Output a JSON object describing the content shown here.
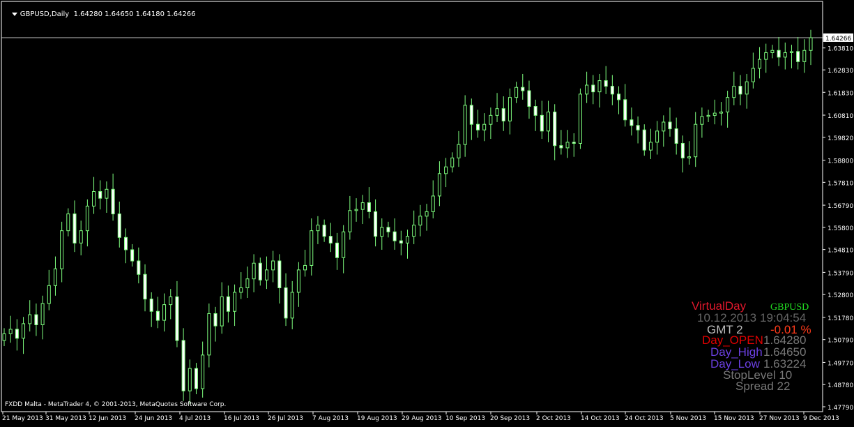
{
  "header": {
    "symbol": "GBPUSD,Daily",
    "ohlc": "1.64280 1.64650 1.64180 1.64266"
  },
  "footer": {
    "copyright": "FXDD Malta - MetaTrader 4, © 2001-2013, MetaQuotes Software Corp."
  },
  "price_tag": "1.64266",
  "colors": {
    "background": "#000000",
    "grid": "#ffffff",
    "candle": "#7fff7f",
    "price_line": "#c0c0c0"
  },
  "info_panel": {
    "title": "VirtualDay",
    "symbol": "GBPUSD",
    "date": "10.12.2013",
    "time": "19:04:54",
    "gmt": "GMT 2",
    "change": "-0.01 %",
    "open_label": "Day_OPEN",
    "open_value": "1.64280",
    "high_label": "Day_High",
    "high_value": "1.64650",
    "low_label": "Day_Low",
    "low_value": "1.63224",
    "stoplevel": "StopLevel 10",
    "spread": "Spread  22"
  },
  "chart_data": {
    "type": "candlestick",
    "title": "GBPUSD,Daily",
    "ylim": [
      1.4779,
      1.6458
    ],
    "y_ticks": [
      "1.64266",
      "1.63810",
      "1.62830",
      "1.61830",
      "1.60810",
      "1.59820",
      "1.58800",
      "1.57810",
      "1.56790",
      "1.55800",
      "1.54810",
      "1.53790",
      "1.52800",
      "1.51780",
      "1.50790",
      "1.49770",
      "1.48780",
      "1.47790"
    ],
    "x_ticks": [
      "21 May 2013",
      "31 May 2013",
      "12 Jun 2013",
      "24 Jun 2013",
      "4 Jul 2013",
      "16 Jul 2013",
      "26 Jul 2013",
      "7 Aug 2013",
      "19 Aug 2013",
      "29 Aug 2013",
      "10 Sep 2013",
      "20 Sep 2013",
      "2 Oct 2013",
      "14 Oct 2013",
      "24 Oct 2013",
      "5 Nov 2013",
      "15 Nov 2013",
      "27 Nov 2013",
      "9 Dec 2013"
    ],
    "closes": [
      1.5105,
      1.5125,
      1.5085,
      1.515,
      1.519,
      1.5145,
      1.524,
      1.532,
      1.5395,
      1.5565,
      1.564,
      1.551,
      1.5565,
      1.5675,
      1.574,
      1.571,
      1.575,
      1.564,
      1.5535,
      1.548,
      1.543,
      1.537,
      1.526,
      1.5205,
      1.5165,
      1.5235,
      1.527,
      1.5075,
      1.485,
      1.495,
      1.486,
      1.501,
      1.5195,
      1.514,
      1.527,
      1.5205,
      1.529,
      1.531,
      1.535,
      1.542,
      1.5345,
      1.539,
      1.543,
      1.531,
      1.5175,
      1.529,
      1.539,
      1.541,
      1.5565,
      1.559,
      1.554,
      1.551,
      1.5445,
      1.556,
      1.5655,
      1.566,
      1.569,
      1.565,
      1.554,
      1.558,
      1.556,
      1.552,
      1.551,
      1.554,
      1.559,
      1.563,
      1.565,
      1.572,
      1.582,
      1.585,
      1.589,
      1.595,
      1.6125,
      1.604,
      1.6015,
      1.604,
      1.608,
      1.611,
      1.6055,
      1.616,
      1.6205,
      1.619,
      1.612,
      1.608,
      1.601,
      1.6095,
      1.5945,
      1.5935,
      1.596,
      1.5955,
      1.6175,
      1.6215,
      1.6185,
      1.6235,
      1.621,
      1.6175,
      1.615,
      1.606,
      1.6035,
      1.6015,
      1.5925,
      1.596,
      1.601,
      1.605,
      1.602,
      1.5955,
      1.589,
      1.5895,
      1.604,
      1.6075,
      1.608,
      1.609,
      1.6095,
      1.616,
      1.621,
      1.6175,
      1.623,
      1.629,
      1.633,
      1.636,
      1.637,
      1.634,
      1.636,
      1.6365,
      1.632,
      1.637,
      1.6427
    ]
  }
}
